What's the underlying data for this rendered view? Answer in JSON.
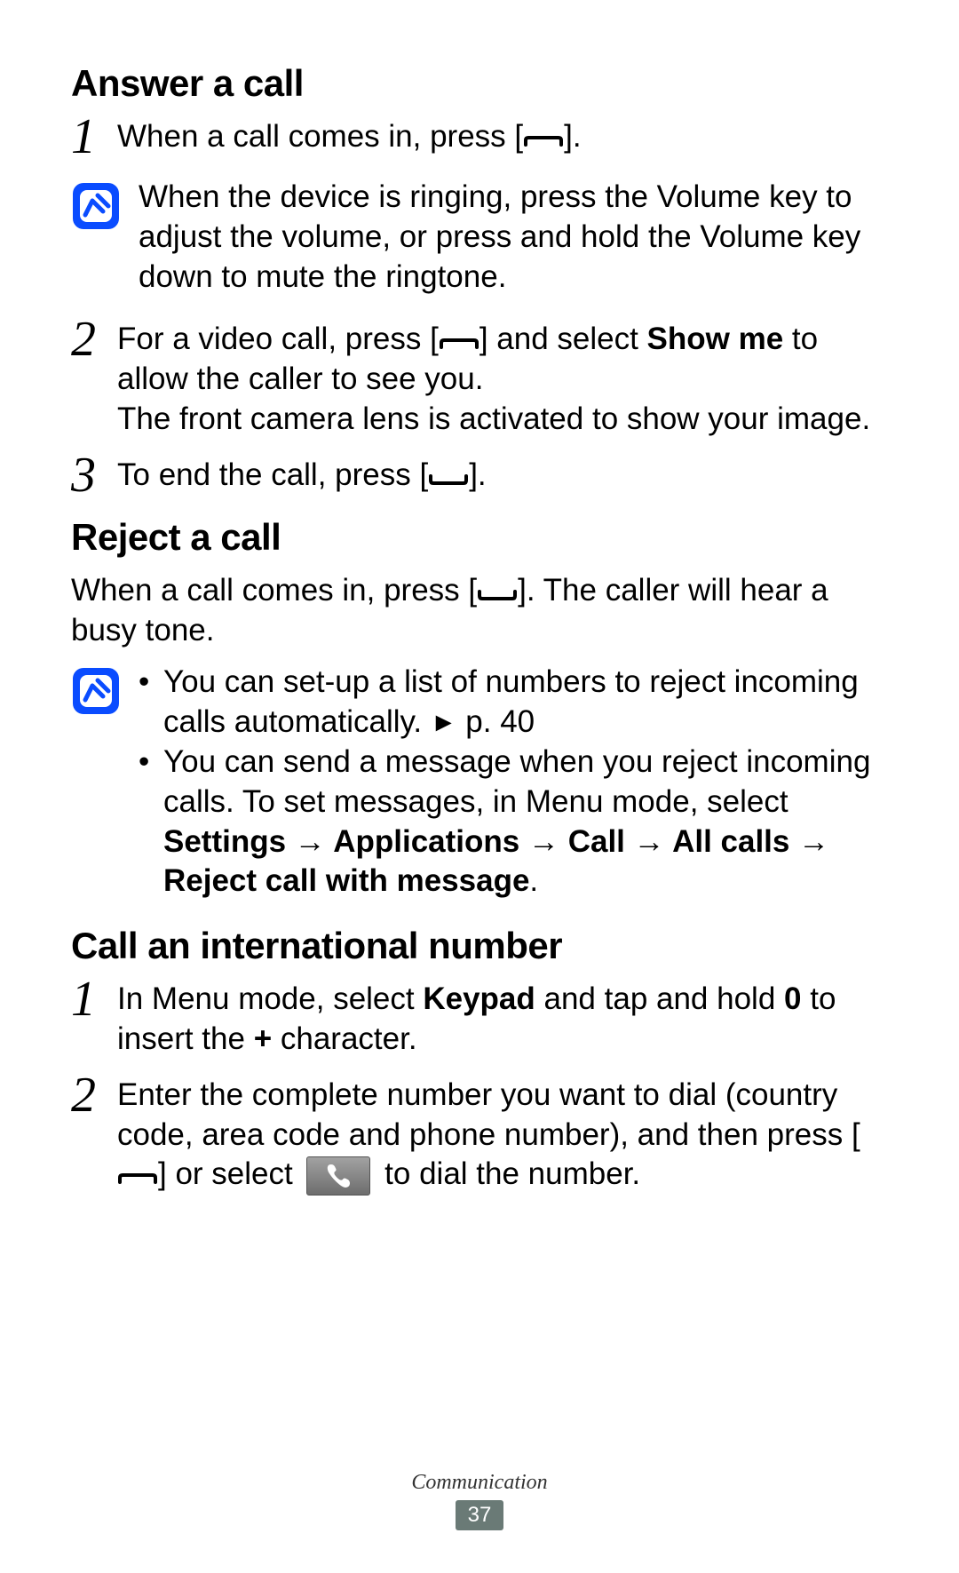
{
  "sections": {
    "answer": {
      "title": "Answer a call",
      "step1_prefix": "When a call comes in, press [",
      "step1_suffix": "].",
      "note1": "When the device is ringing, press the Volume key to adjust the volume, or press and hold the Volume key down to mute the ringtone.",
      "step2_a": "For a video call, press [",
      "step2_b": "] and select ",
      "step2_bold": "Show me",
      "step2_c": " to allow the caller to see you.",
      "step2_line2": "The front camera lens is activated to show your image.",
      "step3_a": "To end the call, press [",
      "step3_b": "]."
    },
    "reject": {
      "title": "Reject a call",
      "para_a": "When a call comes in, press [",
      "para_b": "]. The caller will hear a busy tone.",
      "bullet1_a": "You can set-up a list of numbers to reject incoming calls automatically. ",
      "bullet1_tri": "►",
      "bullet1_b": " p. 40",
      "bullet2_a": "You can send a message when you reject incoming calls. To set messages, in Menu mode, select ",
      "bullet2_settings": "Settings",
      "bullet2_arrow": " → ",
      "bullet2_apps": "Applications",
      "bullet2_call": "Call",
      "bullet2_all": "All calls",
      "bullet2_reject": "Reject call with message",
      "bullet2_period": "."
    },
    "intl": {
      "title": "Call an international number",
      "step1_a": "In Menu mode, select ",
      "step1_keypad": "Keypad",
      "step1_b": " and tap and hold ",
      "step1_zero": "0",
      "step1_c": " to insert the ",
      "step1_plus": "+",
      "step1_d": " character.",
      "step2_a": "Enter the complete number you want to dial (country code, area code and phone number), and then press [",
      "step2_b": "] or select ",
      "step2_c": " to dial the number."
    }
  },
  "footer": {
    "section": "Communication",
    "page": "37"
  },
  "nums": {
    "one": "1",
    "two": "2",
    "three": "3"
  },
  "bullets": {
    "dot": "•"
  }
}
